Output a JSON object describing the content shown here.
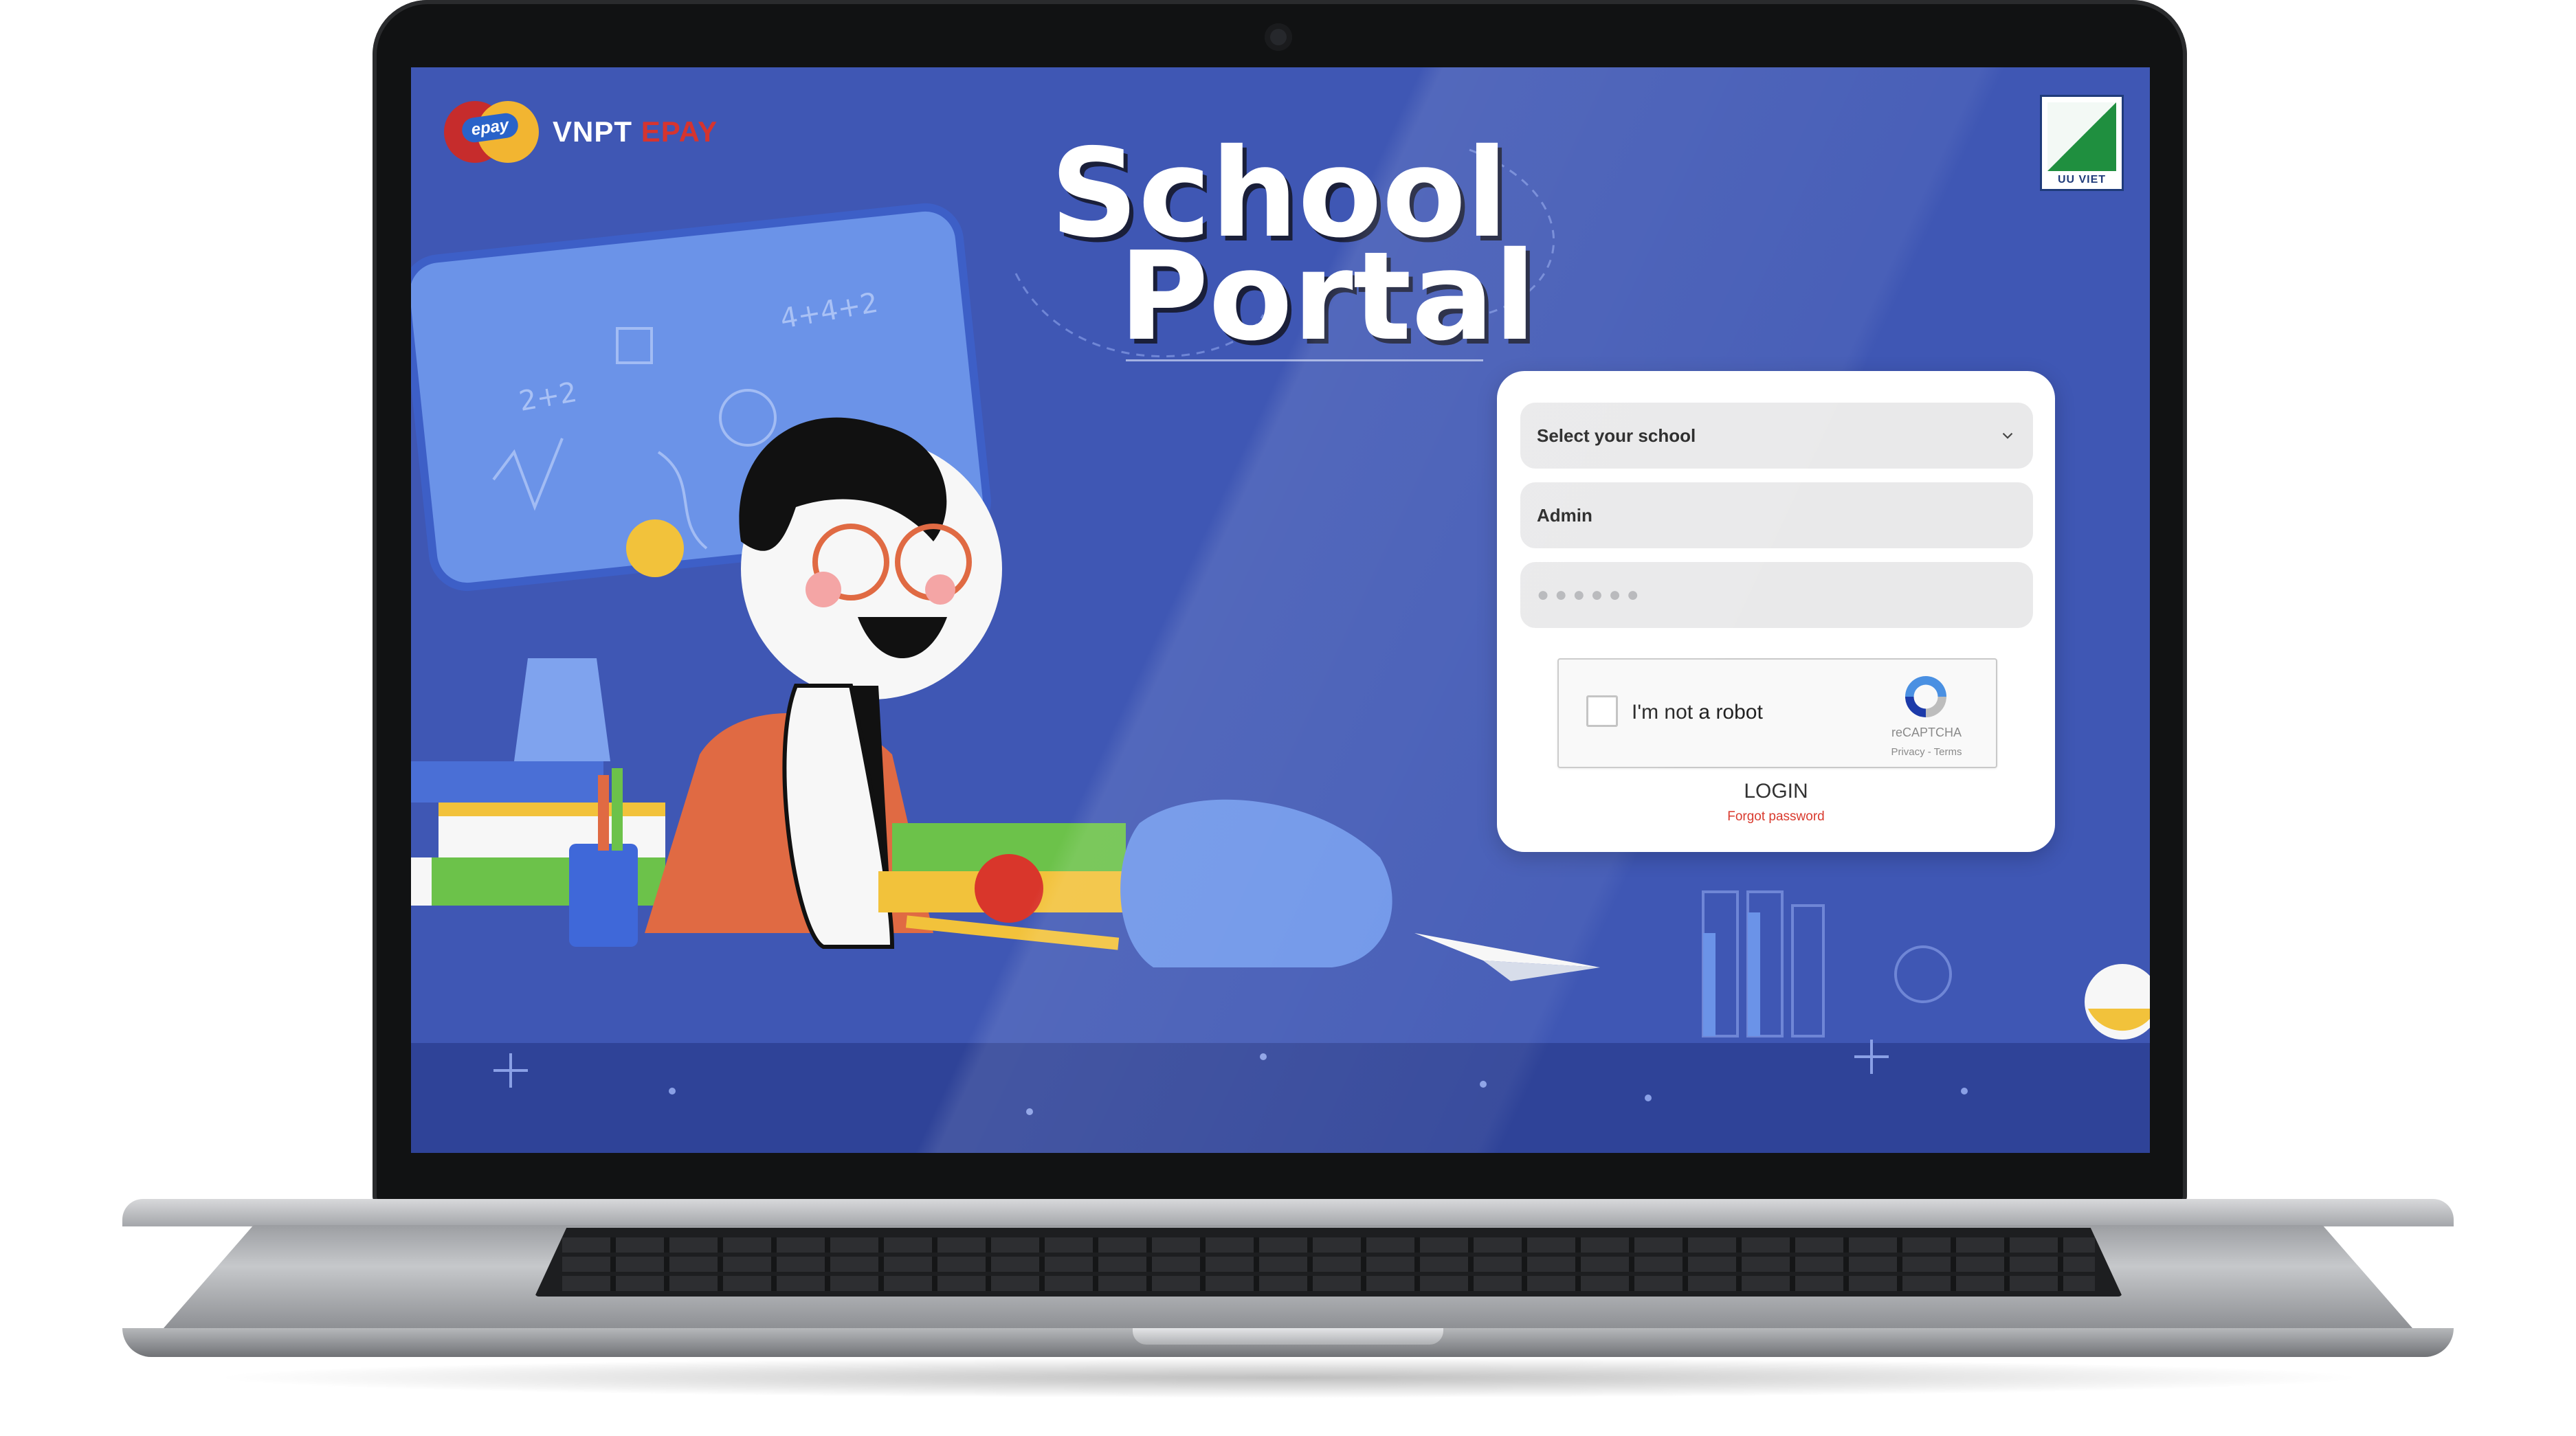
{
  "portal": {
    "title_line1": "School",
    "title_line2": "Portal"
  },
  "brand": {
    "mark_text": "epay",
    "name_prefix": "VNPT",
    "name_suffix": "EPAY",
    "partner_label": "UU VIET"
  },
  "login": {
    "school_select_placeholder": "Select your school",
    "username_value": "Admin",
    "password_mask": "●●●●●●",
    "captcha_label": "I'm not a robot",
    "captcha_brand": "reCAPTCHA",
    "captcha_links": "Privacy - Terms",
    "login_label": "LOGIN",
    "forgot_label": "Forgot password"
  },
  "colors": {
    "screen_bg": "#3f57b4",
    "accent_red": "#d93a2e",
    "card_bg": "#ffffff",
    "field_bg": "#e9e9ea"
  },
  "icons": [
    "epay-logo-icon",
    "uuviet-logo-icon",
    "chevron-down-icon",
    "recaptcha-icon",
    "webcam-icon"
  ]
}
